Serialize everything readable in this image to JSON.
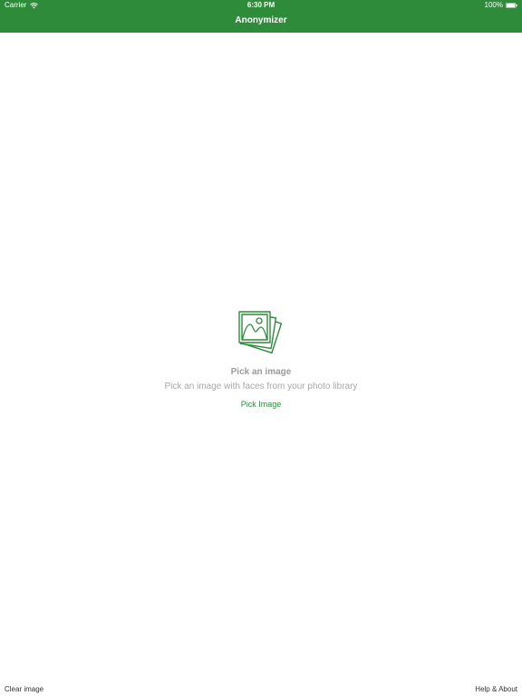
{
  "status_bar": {
    "carrier": "Carrier",
    "time": "6:30 PM",
    "battery": "100%"
  },
  "nav": {
    "title": "Anonymizer"
  },
  "empty_state": {
    "icon": "photos-icon",
    "title": "Pick an image",
    "subtitle": "Pick an image with faces from your photo library",
    "button_label": "Pick Image"
  },
  "toolbar": {
    "clear_label": "Clear image",
    "help_label": "Help & About"
  },
  "colors": {
    "accent": "#2e8b3a",
    "title_gray": "#9b9b9b",
    "subtitle_gray": "#a8a8a8"
  }
}
